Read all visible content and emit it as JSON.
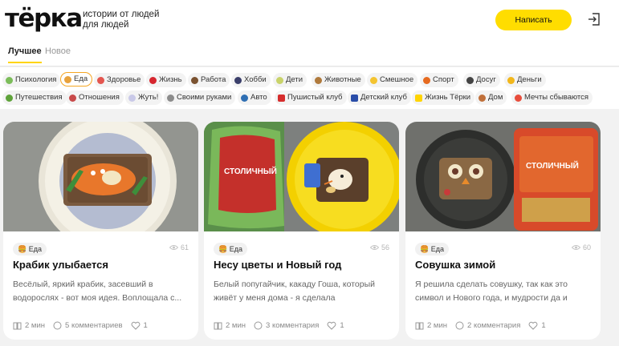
{
  "header": {
    "logo": "тёрка",
    "tagline": "истории от людей для людей",
    "write_button": "Написать",
    "login_icon": "login-icon",
    "accent": "#ffdd00"
  },
  "tabs": [
    {
      "label": "Лучшее",
      "active": true
    },
    {
      "label": "Новое",
      "active": false
    }
  ],
  "categories": [
    {
      "label": "Психология",
      "icon": "sprout-icon"
    },
    {
      "label": "Еда",
      "icon": "burger-icon",
      "active": true
    },
    {
      "label": "Здоровье",
      "icon": "pill-icon"
    },
    {
      "label": "Жизнь",
      "icon": "heart-icon"
    },
    {
      "label": "Работа",
      "icon": "briefcase-icon"
    },
    {
      "label": "Хобби",
      "icon": "game-icon"
    },
    {
      "label": "Дети",
      "icon": "bottle-icon"
    },
    {
      "label": "Животные",
      "icon": "dog-icon"
    },
    {
      "label": "Смешное",
      "icon": "smile-icon"
    },
    {
      "label": "Спорт",
      "icon": "ball-icon"
    },
    {
      "label": "Досуг",
      "icon": "gamepad-icon"
    },
    {
      "label": "Деньги",
      "icon": "coin-icon"
    },
    {
      "label": "Путешествия",
      "icon": "palm-icon"
    },
    {
      "label": "Отношения",
      "icon": "couple-icon"
    },
    {
      "label": "Жуть!",
      "icon": "ghost-icon"
    },
    {
      "label": "Своими руками",
      "icon": "tools-icon"
    },
    {
      "label": "Авто",
      "icon": "car-icon"
    },
    {
      "label": "Пушистый клуб",
      "icon": "cat-icon"
    },
    {
      "label": "Детский клуб",
      "icon": "kid-icon"
    },
    {
      "label": "Жизнь Тёрки",
      "icon": "terka-icon"
    },
    {
      "label": "Дом",
      "icon": "house-icon"
    },
    {
      "label": "Мечты сбываются",
      "icon": "dream-icon"
    }
  ],
  "cards": [
    {
      "tag": "Еда",
      "views": "61",
      "title": "Крабик улыбается",
      "excerpt": "Весёлый, яркий крабик, засевший в водорослях - вот моя идея. Воплощала с...",
      "read_time": "2 мин",
      "comments": "5 комментариев",
      "likes": "1"
    },
    {
      "tag": "Еда",
      "views": "56",
      "title": "Несу цветы и Новый год",
      "excerpt": "Белый попугайчик, какаду Гоша, который живёт у меня дома - я сделала практически...",
      "read_time": "2 мин",
      "comments": "3 комментария",
      "likes": "1"
    },
    {
      "tag": "Еда",
      "views": "60",
      "title": "Совушка зимой",
      "excerpt": "Я решила сделать совушку, так как это символ и Нового года, и мудрости да и просто...",
      "read_time": "2 мин",
      "comments": "2 комментария",
      "likes": "1"
    }
  ],
  "bread_label": "СТОЛИЧНЫЙ"
}
